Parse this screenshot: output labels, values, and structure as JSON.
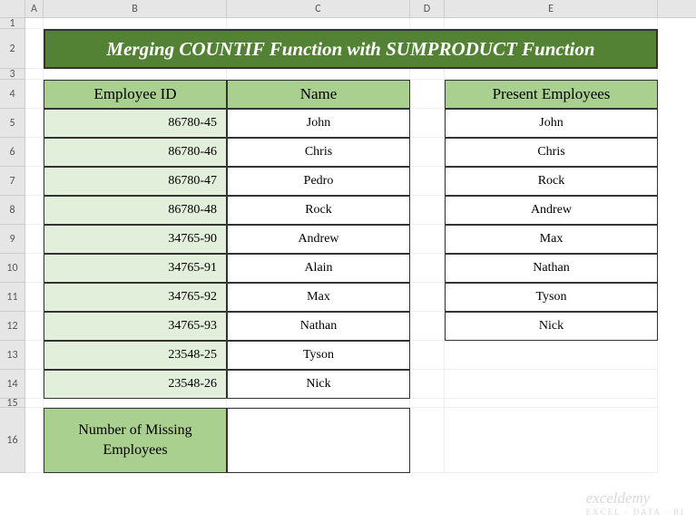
{
  "columns": [
    "A",
    "B",
    "C",
    "D",
    "E"
  ],
  "rows": [
    "1",
    "2",
    "3",
    "4",
    "5",
    "6",
    "7",
    "8",
    "9",
    "10",
    "11",
    "12",
    "13",
    "14",
    "15",
    "16"
  ],
  "title": "Merging COUNTIF Function with SUMPRODUCT Function",
  "headers": {
    "employee_id": "Employee ID",
    "name": "Name",
    "present": "Present Employees"
  },
  "employees": [
    {
      "id": "86780-45",
      "name": "John"
    },
    {
      "id": "86780-46",
      "name": "Chris"
    },
    {
      "id": "86780-47",
      "name": "Pedro"
    },
    {
      "id": "86780-48",
      "name": "Rock"
    },
    {
      "id": "34765-90",
      "name": "Andrew"
    },
    {
      "id": "34765-91",
      "name": "Alain"
    },
    {
      "id": "34765-92",
      "name": "Max"
    },
    {
      "id": "34765-93",
      "name": "Nathan"
    },
    {
      "id": "23548-25",
      "name": "Tyson"
    },
    {
      "id": "23548-26",
      "name": "Nick"
    }
  ],
  "present": [
    "John",
    "Chris",
    "Rock",
    "Andrew",
    "Max",
    "Nathan",
    "Tyson",
    "Nick"
  ],
  "missing_label": "Number of Missing Employees",
  "missing_value": "",
  "watermark": {
    "main": "exceldemy",
    "sub": "EXCEL · DATA · BI"
  }
}
